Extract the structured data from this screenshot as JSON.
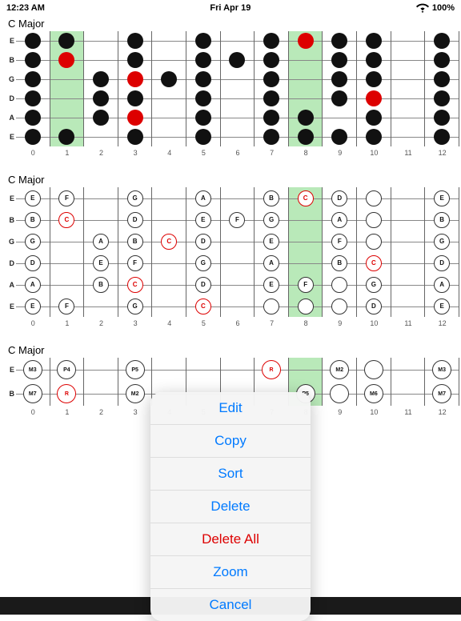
{
  "statusBar": {
    "time": "12:23 AM",
    "day": "Fri Apr 19",
    "battery": "100%",
    "wifiIcon": "wifi-icon",
    "batteryIcon": "battery-icon"
  },
  "sections": [
    {
      "label": "C Major",
      "strings": [
        "E",
        "B",
        "G",
        "D",
        "A",
        "E"
      ],
      "frets": [
        "0",
        "1",
        "2",
        "3",
        "4",
        "5",
        "6",
        "7",
        "8",
        "9",
        "10",
        "11",
        "12"
      ],
      "numFrets": 13,
      "greenCols": [
        1,
        8
      ],
      "dots": [
        {
          "string": 0,
          "fret": 0,
          "type": "black"
        },
        {
          "string": 0,
          "fret": 1,
          "type": "black"
        },
        {
          "string": 0,
          "fret": 3,
          "type": "black"
        },
        {
          "string": 0,
          "fret": 5,
          "type": "black"
        },
        {
          "string": 0,
          "fret": 7,
          "type": "black"
        },
        {
          "string": 0,
          "fret": 8,
          "type": "red"
        },
        {
          "string": 0,
          "fret": 9,
          "type": "black"
        },
        {
          "string": 0,
          "fret": 10,
          "type": "black"
        },
        {
          "string": 0,
          "fret": 12,
          "type": "black"
        },
        {
          "string": 1,
          "fret": 0,
          "type": "black"
        },
        {
          "string": 1,
          "fret": 1,
          "type": "red"
        },
        {
          "string": 1,
          "fret": 3,
          "type": "black"
        },
        {
          "string": 1,
          "fret": 5,
          "type": "black"
        },
        {
          "string": 1,
          "fret": 6,
          "type": "black"
        },
        {
          "string": 1,
          "fret": 7,
          "type": "black"
        },
        {
          "string": 1,
          "fret": 9,
          "type": "black"
        },
        {
          "string": 1,
          "fret": 10,
          "type": "black"
        },
        {
          "string": 1,
          "fret": 12,
          "type": "black"
        },
        {
          "string": 2,
          "fret": 0,
          "type": "black"
        },
        {
          "string": 2,
          "fret": 2,
          "type": "black"
        },
        {
          "string": 2,
          "fret": 3,
          "type": "red"
        },
        {
          "string": 2,
          "fret": 4,
          "type": "black"
        },
        {
          "string": 2,
          "fret": 5,
          "type": "black"
        },
        {
          "string": 2,
          "fret": 7,
          "type": "black"
        },
        {
          "string": 2,
          "fret": 9,
          "type": "black"
        },
        {
          "string": 2,
          "fret": 10,
          "type": "black"
        },
        {
          "string": 2,
          "fret": 12,
          "type": "black"
        },
        {
          "string": 3,
          "fret": 0,
          "type": "black"
        },
        {
          "string": 3,
          "fret": 2,
          "type": "black"
        },
        {
          "string": 3,
          "fret": 3,
          "type": "black"
        },
        {
          "string": 3,
          "fret": 5,
          "type": "black"
        },
        {
          "string": 3,
          "fret": 7,
          "type": "black"
        },
        {
          "string": 3,
          "fret": 9,
          "type": "black"
        },
        {
          "string": 3,
          "fret": 10,
          "type": "red"
        },
        {
          "string": 3,
          "fret": 12,
          "type": "black"
        },
        {
          "string": 4,
          "fret": 0,
          "type": "black"
        },
        {
          "string": 4,
          "fret": 2,
          "type": "black"
        },
        {
          "string": 4,
          "fret": 3,
          "type": "red"
        },
        {
          "string": 4,
          "fret": 5,
          "type": "black"
        },
        {
          "string": 4,
          "fret": 7,
          "type": "black"
        },
        {
          "string": 4,
          "fret": 8,
          "type": "black"
        },
        {
          "string": 4,
          "fret": 10,
          "type": "black"
        },
        {
          "string": 4,
          "fret": 12,
          "type": "black"
        },
        {
          "string": 5,
          "fret": 0,
          "type": "black"
        },
        {
          "string": 5,
          "fret": 1,
          "type": "black"
        },
        {
          "string": 5,
          "fret": 3,
          "type": "black"
        },
        {
          "string": 5,
          "fret": 5,
          "type": "black"
        },
        {
          "string": 5,
          "fret": 7,
          "type": "black"
        },
        {
          "string": 5,
          "fret": 8,
          "type": "black"
        },
        {
          "string": 5,
          "fret": 9,
          "type": "black"
        },
        {
          "string": 5,
          "fret": 10,
          "type": "black"
        },
        {
          "string": 5,
          "fret": 12,
          "type": "black"
        }
      ]
    },
    {
      "label": "C Major",
      "strings": [
        "E",
        "B",
        "G",
        "D",
        "A",
        "E"
      ],
      "frets": [
        "0",
        "1",
        "2",
        "3",
        "4",
        "5",
        "6",
        "7",
        "8",
        "9",
        "10",
        "11",
        "12"
      ],
      "numFrets": 13,
      "greenCols": [
        8
      ],
      "noteLabels": true,
      "dots": [
        {
          "string": 0,
          "fret": 0,
          "label": "E",
          "type": "outline"
        },
        {
          "string": 0,
          "fret": 1,
          "label": "F",
          "type": "outline"
        },
        {
          "string": 0,
          "fret": 3,
          "label": "G",
          "type": "outline"
        },
        {
          "string": 0,
          "fret": 5,
          "label": "A",
          "type": "outline"
        },
        {
          "string": 0,
          "fret": 7,
          "label": "B",
          "type": "outline"
        },
        {
          "string": 0,
          "fret": 8,
          "label": "C",
          "type": "red-outline"
        },
        {
          "string": 0,
          "fret": 9,
          "label": "D",
          "type": "outline"
        },
        {
          "string": 0,
          "fret": 10,
          "label": "",
          "type": "outline"
        },
        {
          "string": 0,
          "fret": 12,
          "label": "E",
          "type": "outline"
        },
        {
          "string": 1,
          "fret": 0,
          "label": "B",
          "type": "outline"
        },
        {
          "string": 1,
          "fret": 1,
          "label": "C",
          "type": "red-outline"
        },
        {
          "string": 1,
          "fret": 3,
          "label": "D",
          "type": "outline"
        },
        {
          "string": 1,
          "fret": 5,
          "label": "E",
          "type": "outline"
        },
        {
          "string": 1,
          "fret": 6,
          "label": "F",
          "type": "outline"
        },
        {
          "string": 1,
          "fret": 7,
          "label": "G",
          "type": "outline"
        },
        {
          "string": 1,
          "fret": 9,
          "label": "A",
          "type": "outline"
        },
        {
          "string": 1,
          "fret": 10,
          "label": "",
          "type": "outline"
        },
        {
          "string": 1,
          "fret": 12,
          "label": "B",
          "type": "outline"
        },
        {
          "string": 2,
          "fret": 0,
          "label": "G",
          "type": "outline"
        },
        {
          "string": 2,
          "fret": 2,
          "label": "A",
          "type": "outline"
        },
        {
          "string": 2,
          "fret": 3,
          "label": "B",
          "type": "outline"
        },
        {
          "string": 2,
          "fret": 4,
          "label": "C",
          "type": "red-outline"
        },
        {
          "string": 2,
          "fret": 5,
          "label": "D",
          "type": "outline"
        },
        {
          "string": 2,
          "fret": 7,
          "label": "E",
          "type": "outline"
        },
        {
          "string": 2,
          "fret": 9,
          "label": "F",
          "type": "outline"
        },
        {
          "string": 2,
          "fret": 10,
          "label": "",
          "type": "outline"
        },
        {
          "string": 2,
          "fret": 12,
          "label": "G",
          "type": "outline"
        },
        {
          "string": 3,
          "fret": 0,
          "label": "D",
          "type": "outline"
        },
        {
          "string": 3,
          "fret": 2,
          "label": "E",
          "type": "outline"
        },
        {
          "string": 3,
          "fret": 3,
          "label": "F",
          "type": "outline"
        },
        {
          "string": 3,
          "fret": 5,
          "label": "G",
          "type": "outline"
        },
        {
          "string": 3,
          "fret": 7,
          "label": "A",
          "type": "outline"
        },
        {
          "string": 3,
          "fret": 9,
          "label": "B",
          "type": "outline"
        },
        {
          "string": 3,
          "fret": 10,
          "label": "C",
          "type": "red-outline"
        },
        {
          "string": 3,
          "fret": 12,
          "label": "D",
          "type": "outline"
        },
        {
          "string": 4,
          "fret": 0,
          "label": "A",
          "type": "outline"
        },
        {
          "string": 4,
          "fret": 2,
          "label": "B",
          "type": "outline"
        },
        {
          "string": 4,
          "fret": 3,
          "label": "C",
          "type": "red-outline"
        },
        {
          "string": 4,
          "fret": 5,
          "label": "D",
          "type": "outline"
        },
        {
          "string": 4,
          "fret": 7,
          "label": "E",
          "type": "outline"
        },
        {
          "string": 4,
          "fret": 8,
          "label": "F",
          "type": "outline"
        },
        {
          "string": 4,
          "fret": 9,
          "label": "",
          "type": "outline"
        },
        {
          "string": 4,
          "fret": 10,
          "label": "G",
          "type": "outline"
        },
        {
          "string": 4,
          "fret": 12,
          "label": "A",
          "type": "outline"
        },
        {
          "string": 5,
          "fret": 0,
          "label": "E",
          "type": "outline"
        },
        {
          "string": 5,
          "fret": 1,
          "label": "F",
          "type": "outline"
        },
        {
          "string": 5,
          "fret": 3,
          "label": "G",
          "type": "outline"
        },
        {
          "string": 5,
          "fret": 5,
          "label": "C",
          "type": "red-outline"
        },
        {
          "string": 5,
          "fret": 7,
          "label": "",
          "type": "outline"
        },
        {
          "string": 5,
          "fret": 8,
          "label": "",
          "type": "outline"
        },
        {
          "string": 5,
          "fret": 9,
          "label": "",
          "type": "outline"
        },
        {
          "string": 5,
          "fret": 10,
          "label": "D",
          "type": "outline"
        },
        {
          "string": 5,
          "fret": 12,
          "label": "E",
          "type": "outline"
        }
      ]
    },
    {
      "label": "C Major",
      "strings": [
        "E",
        "B"
      ],
      "frets": [
        "0",
        "1",
        "2",
        "3",
        "4",
        "5",
        "6",
        "7",
        "8",
        "9",
        "10",
        "11",
        "12"
      ],
      "numFrets": 13,
      "greenCols": [
        8
      ],
      "noteLabels": true,
      "dots": [
        {
          "string": 0,
          "fret": 0,
          "label": "M3",
          "type": "outline"
        },
        {
          "string": 0,
          "fret": 1,
          "label": "P4",
          "type": "outline"
        },
        {
          "string": 0,
          "fret": 3,
          "label": "P5",
          "type": "outline"
        },
        {
          "string": 0,
          "fret": 7,
          "label": "R",
          "type": "red-outline"
        },
        {
          "string": 0,
          "fret": 9,
          "label": "M2",
          "type": "outline"
        },
        {
          "string": 0,
          "fret": 10,
          "label": "",
          "type": "outline"
        },
        {
          "string": 0,
          "fret": 12,
          "label": "M3",
          "type": "outline"
        },
        {
          "string": 1,
          "fret": 0,
          "label": "M7",
          "type": "outline"
        },
        {
          "string": 1,
          "fret": 1,
          "label": "R",
          "type": "red-outline"
        },
        {
          "string": 1,
          "fret": 3,
          "label": "M2",
          "type": "outline"
        },
        {
          "string": 1,
          "fret": 8,
          "label": "P5",
          "type": "outline"
        },
        {
          "string": 1,
          "fret": 9,
          "label": "",
          "type": "outline"
        },
        {
          "string": 1,
          "fret": 10,
          "label": "M6",
          "type": "outline"
        },
        {
          "string": 1,
          "fret": 12,
          "label": "M7",
          "type": "outline"
        }
      ]
    }
  ],
  "contextMenu": {
    "items": [
      {
        "label": "Edit",
        "type": "blue"
      },
      {
        "label": "Copy",
        "type": "blue"
      },
      {
        "label": "Sort",
        "type": "blue"
      },
      {
        "label": "Delete",
        "type": "blue"
      },
      {
        "label": "Delete All",
        "type": "red"
      },
      {
        "label": "Zoom",
        "type": "blue"
      },
      {
        "label": "Cancel",
        "type": "blue"
      }
    ]
  }
}
